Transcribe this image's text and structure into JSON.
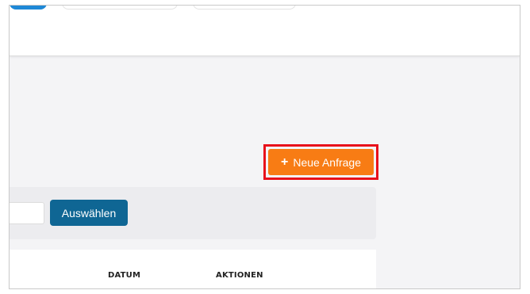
{
  "header": {
    "tabs": [
      {
        "label": "",
        "active": true
      },
      {
        "label": "",
        "active": false
      },
      {
        "label": "",
        "active": false
      }
    ]
  },
  "actions": {
    "new_request_label": "Neue Anfrage",
    "new_request_icon": "plus-icon",
    "highlight_color": "#e8111b",
    "button_color": "#f87c14"
  },
  "filter": {
    "input_value": "",
    "select_label": "Auswählen",
    "select_color": "#0f6694"
  },
  "table": {
    "columns": [
      "DATUM",
      "AKTIONEN"
    ]
  }
}
